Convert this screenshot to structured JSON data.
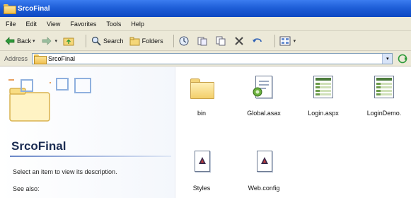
{
  "window": {
    "title": "SrcoFinal"
  },
  "menu": [
    "File",
    "Edit",
    "View",
    "Favorites",
    "Tools",
    "Help"
  ],
  "toolbar": {
    "back_label": "Back",
    "search_label": "Search",
    "folders_label": "Folders"
  },
  "address": {
    "label": "Address",
    "value": "SrcoFinal"
  },
  "taskpane": {
    "title": "SrcoFinal",
    "description": "Select an item to view its description.",
    "see_also": "See also:"
  },
  "files": [
    {
      "name": "bin",
      "icon": "folder-icon"
    },
    {
      "name": "Global.asax",
      "icon": "asax-file-icon"
    },
    {
      "name": "Login.aspx",
      "icon": "aspx-file-icon"
    },
    {
      "name": "LoginDemo.",
      "icon": "aspx-file-icon"
    },
    {
      "name": "Styles",
      "icon": "css-file-icon"
    },
    {
      "name": "Web.config",
      "icon": "config-file-icon"
    }
  ],
  "colors": {
    "titlebar": "#1f5fd8",
    "chrome": "#ece9d8",
    "pane_title": "#1b2c52"
  }
}
